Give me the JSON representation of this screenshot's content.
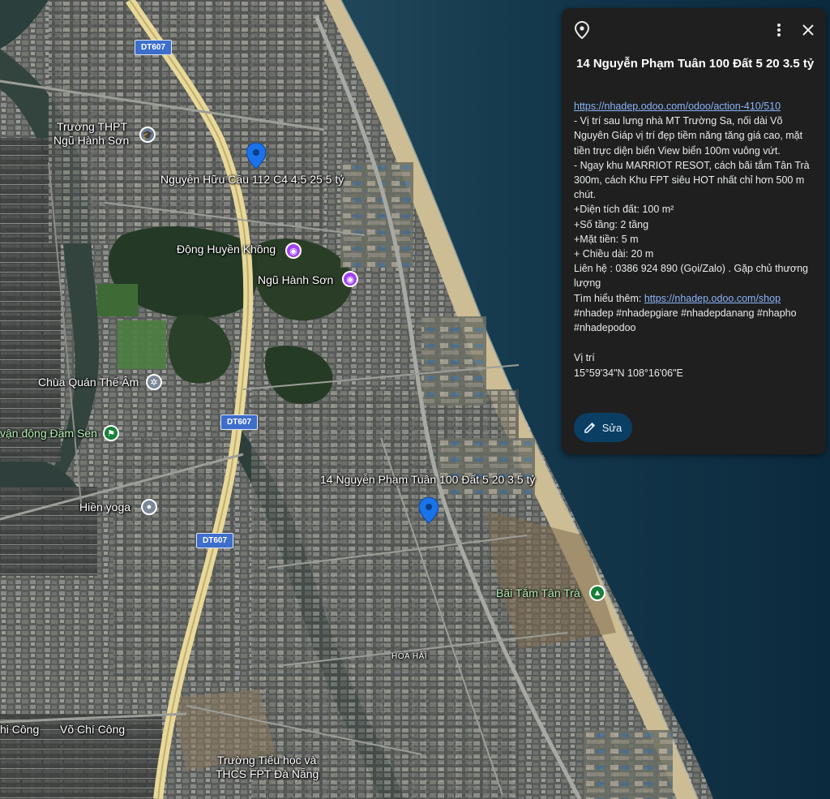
{
  "map": {
    "labels": {
      "truong_thpt_1": "Trường THPT",
      "truong_thpt_2": "Ngũ Hành Sơn",
      "nguyen_huu_cau": "Nguyễn Hữu Cầu 112 C4 4.5 25 5 tỷ",
      "dong_huyen_khong": "Động Huyền Không",
      "ngu_hanh_son": "Ngũ Hành Sơn",
      "chua_quan_the_am": "Chùa Quán Thế Âm",
      "van_dong_dam_sen": "vận động Đầm Sen",
      "hien_yoga": "Hiền yoga",
      "nguyen_pham_tuan": "14 Nguyễn Phạm Tuân 100 Đất 5 20 3.5 tỷ",
      "bai_tam_tan_tra": "Bãi Tắm Tân Trà",
      "hoa_hai": "HÒA HẢI",
      "chi_cong_left": "hi Công",
      "vo_chi_cong": "Võ Chí Công",
      "truong_tieu_hoc_1": "Trường Tiểu học và",
      "truong_tieu_hoc_2": "THCS FPT Đà Nẵng"
    },
    "road_shields": [
      "DT607",
      "DT607",
      "DT607"
    ]
  },
  "panel": {
    "title": "14 Nguyễn Phạm Tuân 100 Đất 5 20 3.5 tỷ",
    "link1": "https://nhadep.odoo.com/odoo/action-410/510",
    "lines": [
      "- Vị trí sau lưng nhà MT Trường Sa, nối dài Võ Nguyên Giáp vị trí đẹp tiềm năng tăng giá cao, mặt tiền trực diện biển View biển 100m vuông vứt.",
      "- Ngay khu MARRIOT RESOT, cách bãi tắm Tân Trà 300m, cách Khu FPT siêu HOT nhất chỉ hơn 500 m chút.",
      "+Diện tích đất: 100  m²",
      "+Số tầng: 2 tầng",
      "+Mặt tiền: 5  m",
      "+ Chiều dài: 20 m",
      "Liên hệ : 0386 924 890 (Gọi/Zalo) . Gặp chủ thương lượng"
    ],
    "more_prefix": "Tìm hiểu thêm: ",
    "link2": "https://nhadep.odoo.com/shop",
    "hashtags": "#nhadep  #nhadepgiare #nhadepdanang #nhapho #nhadepodoo",
    "coord_label": "Vị trí",
    "coord_value": "15°59'34\"N 108°16'06\"E",
    "edit_label": "Sửa",
    "icons": [
      "place-icon",
      "more-vert-icon",
      "close-icon",
      "edit-icon"
    ]
  }
}
